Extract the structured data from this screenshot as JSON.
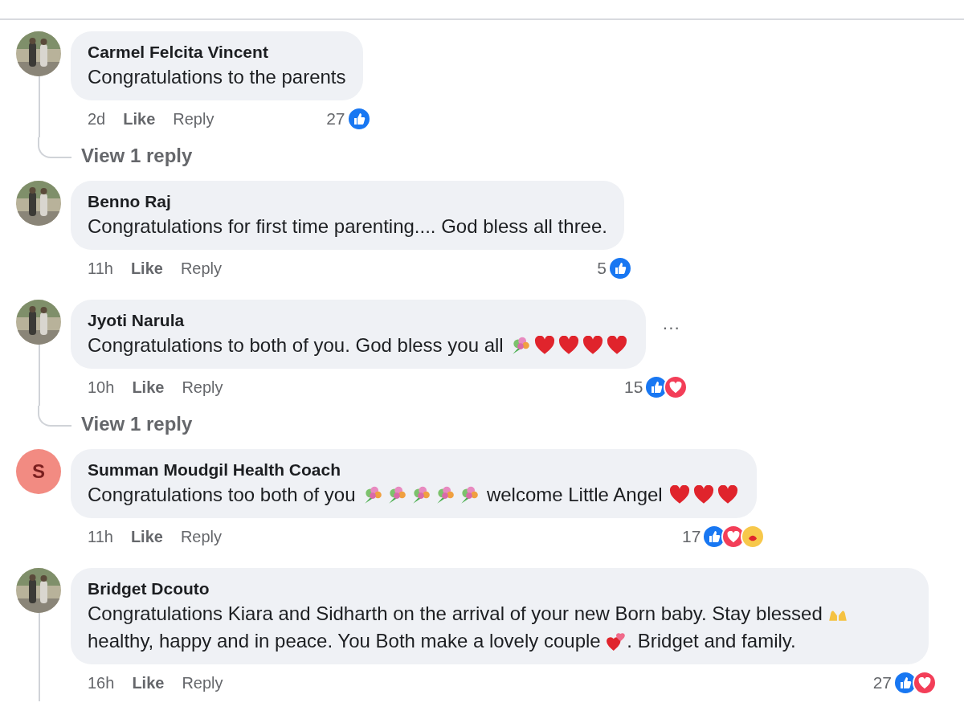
{
  "comments": [
    {
      "author": "Carmel Felcita Vincent",
      "avatar": {
        "kind": "picture"
      },
      "body": [
        {
          "kind": "text",
          "text": "Congratulations to the parents"
        }
      ],
      "time": "2d",
      "like": "Like",
      "reply": "Reply",
      "count": "27",
      "reactions": [
        {
          "kind": "like"
        }
      ],
      "thread": true,
      "reply_link": "View 1 reply",
      "menu": false
    },
    {
      "author": "Benno Raj",
      "avatar": {
        "kind": "picture"
      },
      "body": [
        {
          "kind": "text",
          "text": "Congratulations for first time parenting.... God bless all three."
        }
      ],
      "time": "11h",
      "like": "Like",
      "reply": "Reply",
      "count": "5",
      "reactions": [
        {
          "kind": "like"
        }
      ],
      "thread": false,
      "menu": false
    },
    {
      "author": "Jyoti Narula",
      "avatar": {
        "kind": "picture"
      },
      "body": [
        {
          "kind": "text",
          "text": "Congratulations to both of you. God bless you all "
        },
        {
          "kind": "bouquet"
        },
        {
          "kind": "heart"
        },
        {
          "kind": "heart"
        },
        {
          "kind": "heart"
        },
        {
          "kind": "heart"
        }
      ],
      "time": "10h",
      "like": "Like",
      "reply": "Reply",
      "count": "15",
      "reactions": [
        {
          "kind": "like"
        },
        {
          "kind": "love"
        }
      ],
      "thread": true,
      "reply_link": "View 1 reply",
      "menu": true,
      "menu_label": "···"
    },
    {
      "author": "Summan Moudgil Health Coach",
      "avatar": {
        "kind": "letter",
        "letter": "S",
        "color": "#f28b82"
      },
      "body": [
        {
          "kind": "text",
          "text": "Congratulations too both of you "
        },
        {
          "kind": "bouquet"
        },
        {
          "kind": "bouquet"
        },
        {
          "kind": "bouquet"
        },
        {
          "kind": "bouquet"
        },
        {
          "kind": "bouquet"
        },
        {
          "kind": "text",
          "text": " welcome Little Angel "
        },
        {
          "kind": "heart"
        },
        {
          "kind": "heart"
        },
        {
          "kind": "heart"
        }
      ],
      "time": "11h",
      "like": "Like",
      "reply": "Reply",
      "count": "17",
      "reactions": [
        {
          "kind": "like"
        },
        {
          "kind": "love"
        },
        {
          "kind": "care"
        }
      ],
      "thread": false,
      "menu": false
    },
    {
      "author": "Bridget Dcouto",
      "avatar": {
        "kind": "picture"
      },
      "body": [
        {
          "kind": "text",
          "text": "Congratulations Kiara and Sidharth on the arrival of your new Born baby. Stay blessed "
        },
        {
          "kind": "raised-hands"
        },
        {
          "kind": "text",
          "text": " healthy, happy and in peace. You Both make a lovely couple "
        },
        {
          "kind": "two-hearts"
        },
        {
          "kind": "text",
          "text": ". Bridget and family."
        }
      ],
      "time": "16h",
      "like": "Like",
      "reply": "Reply",
      "count": "27",
      "reactions": [
        {
          "kind": "like"
        },
        {
          "kind": "love"
        }
      ],
      "thread": true,
      "menu": false
    }
  ]
}
